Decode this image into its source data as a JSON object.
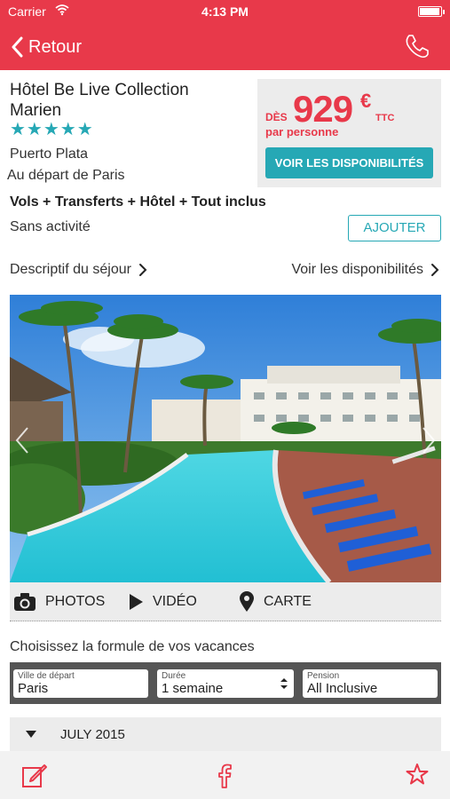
{
  "colors": {
    "accent": "#e8394a",
    "teal": "#26a8b5",
    "panel": "#ececec",
    "filter_bg": "#555555"
  },
  "status_bar": {
    "carrier": "Carrier",
    "time": "4:13 PM"
  },
  "nav": {
    "back_label": "Retour",
    "back_icon": "chevron-left-icon",
    "phone_icon": "phone-icon"
  },
  "hotel": {
    "name": "Hôtel Be Live Collection Marien",
    "stars": "★★★★★",
    "rating": 5,
    "city": "Puerto Plata",
    "departure": "Au départ de Paris"
  },
  "price": {
    "prefix": "DÈS",
    "value": "929",
    "currency": "€",
    "tax": "TTC",
    "per": "par personne",
    "button": "VOIR LES DISPONIBILITÉS"
  },
  "package": {
    "formula": "Vols + Transferts + Hôtel + Tout inclus",
    "activity": "Sans activité",
    "add_button": "AJOUTER"
  },
  "links": {
    "description": "Descriptif du séjour",
    "availability": "Voir les disponibilités"
  },
  "media": {
    "photos": "PHOTOS",
    "video": "VIDÉO",
    "map": "CARTE"
  },
  "booking": {
    "title": "Choisissez la formule de vos vacances",
    "filters": {
      "city": {
        "label": "Ville de départ",
        "value": "Paris"
      },
      "duration": {
        "label": "Durée",
        "value": "1 semaine"
      },
      "board": {
        "label": "Pension",
        "value": "All Inclusive"
      }
    },
    "month": "JULY 2015"
  },
  "footer": {
    "icons": [
      "edit-icon",
      "facebook-icon",
      "star-icon"
    ]
  }
}
